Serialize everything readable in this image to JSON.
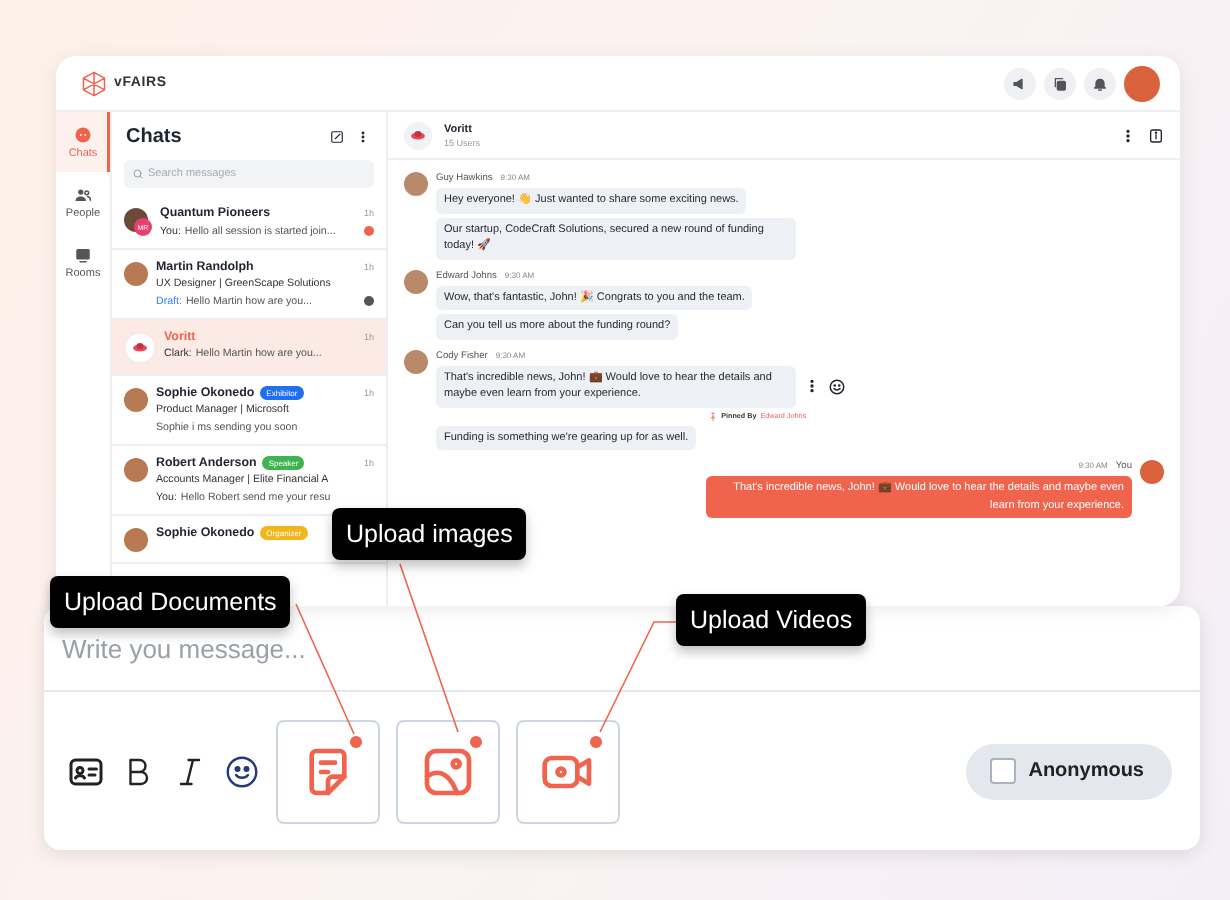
{
  "brand": {
    "name": "vFAIRS"
  },
  "rail": [
    {
      "label": "Chats",
      "selected": true,
      "kind": "chats"
    },
    {
      "label": "People",
      "selected": false,
      "kind": "people"
    },
    {
      "label": "Rooms",
      "selected": false,
      "kind": "rooms"
    }
  ],
  "chats_panel": {
    "title": "Chats",
    "search_placeholder": "Search messages"
  },
  "conversations": [
    {
      "kind": "group",
      "name": "Quantum Pioneers",
      "time": "1h",
      "sender": "You:",
      "preview": "Hello all session is started join...",
      "selected": false,
      "unread_dot": {
        "color": "#f0644e"
      },
      "avatar_initials": "MR"
    },
    {
      "kind": "direct",
      "name": "Martin Randolph",
      "time": "1h",
      "role": "UX Designer | GreenScape Solutions",
      "sender": "Draft:",
      "preview": "Hello Martin how are you...",
      "draft": true,
      "selected": false,
      "unread_dot": {
        "color": "#555555"
      }
    },
    {
      "kind": "room",
      "name": "Voritt",
      "time": "1h",
      "sender": "Clark:",
      "preview": "Hello Martin how are you...",
      "selected": true
    },
    {
      "kind": "direct",
      "name": "Sophie Okonedo",
      "time": "1h",
      "badge": {
        "label": "Exhibitor",
        "color": "#1f6ff0"
      },
      "role": "Product Manager | Microsoft",
      "preview": "Sophie i ms sending you soon",
      "selected": false
    },
    {
      "kind": "direct",
      "name": "Robert Anderson",
      "time": "1h",
      "badge": {
        "label": "Speaker",
        "color": "#3fb34f"
      },
      "role": "Accounts Manager | Elite Financial A",
      "sender": "You:",
      "preview": "Hello Robert send me your resu",
      "selected": false
    },
    {
      "kind": "direct",
      "name": "Sophie Okonedo",
      "badge": {
        "label": "Organizer",
        "color": "#f2b61d"
      },
      "selected": false
    }
  ],
  "chat": {
    "title": "Voritt",
    "subtitle": "15 Users"
  },
  "messages": [
    {
      "kind": "incoming",
      "author": "Guy Hawkins",
      "time": "9:30 AM",
      "bubbles": [
        {
          "text": "Hey everyone! 👋 Just wanted to share some exciting news."
        },
        {
          "text": "Our startup, CodeCraft Solutions, secured a new round of funding today! 🚀"
        }
      ]
    },
    {
      "kind": "incoming",
      "author": "Edward Johns",
      "time": "9:30 AM",
      "bubbles": [
        {
          "text": "Wow, that's fantastic, John! 🎉 Congrats to you and the team."
        },
        {
          "text": "Can you tell us more about the funding round?"
        }
      ]
    },
    {
      "kind": "incoming",
      "author": "Cody Fisher",
      "time": "9:30 AM",
      "bubbles": [
        {
          "text": "That's incredible news, John! 💼 Would love to hear the details and maybe even learn from your experience.",
          "pin": {
            "label": "Pinned By",
            "name": "Edward Johns"
          }
        },
        {
          "text": "Funding is something we're gearing up for as well."
        }
      ]
    },
    {
      "kind": "outgoing",
      "author": "You",
      "time": "9:30 AM",
      "bubbles": [
        {
          "text": "That's incredible news, John! 💼 Would love to hear the details and maybe even learn from your experience."
        }
      ]
    }
  ],
  "composer": {
    "placeholder": "Write you message...",
    "uploads": [
      {
        "kind": "document",
        "tooltip": "Upload Documents"
      },
      {
        "kind": "image",
        "tooltip": "Upload images"
      },
      {
        "kind": "video",
        "tooltip": "Upload Videos"
      }
    ],
    "anonymous": {
      "label": "Anonymous",
      "checked": false
    }
  }
}
